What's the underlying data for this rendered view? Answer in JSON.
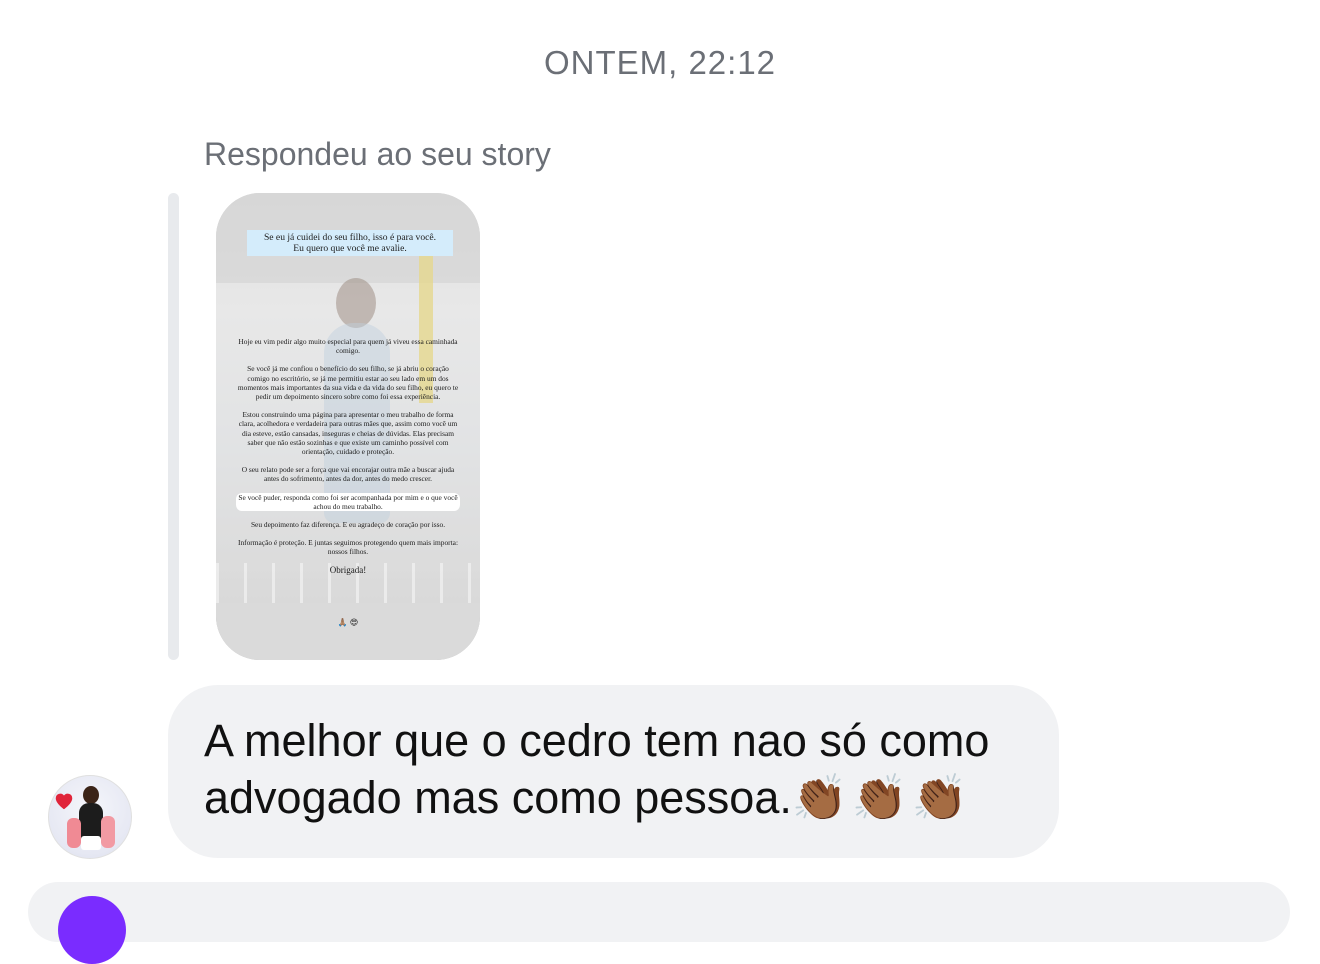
{
  "header": {
    "timestamp": "ONTEM, 22:12"
  },
  "reply": {
    "caption": "Respondeu ao seu story",
    "story": {
      "headline_line1": "Se eu já cuidei do seu filho, isso é para você.",
      "headline_line2": "Eu quero que você me avalie.",
      "paragraphs": [
        "Hoje eu vim pedir algo muito especial para quem já viveu essa caminhada comigo.",
        "Se você já me confiou o benefício do seu filho, se já abriu o coração comigo no escritório, se já me permitiu estar ao seu lado em um dos momentos mais importantes da sua vida e da vida do seu filho, eu quero te pedir um depoimento sincero sobre como foi essa experiência.",
        "Estou construindo uma página para apresentar o meu trabalho de forma clara, acolhedora e verdadeira para outras mães que, assim como você um dia esteve, estão cansadas, inseguras e cheias de dúvidas. Elas precisam saber que não estão sozinhas e que existe um caminho possível com orientação, cuidado e proteção.",
        "O seu relato pode ser a força que vai encorajar outra mãe a buscar ajuda antes do sofrimento, antes da dor, antes do medo crescer.",
        "Se você puder, responda como foi ser acompanhada por mim e o que você achou do meu trabalho.",
        "Seu depoimento faz diferença. E eu agradeço de coração por isso.",
        "Informação é proteção. E juntas seguimos protegendo quem mais importa: nossos filhos.",
        "Obrigada!"
      ],
      "emojis": "🙏🏽 😍"
    }
  },
  "message": {
    "text": "A melhor que o cedro tem nao só como advogado mas como pessoa.",
    "emojis": "👏🏾👏🏾👏🏾"
  },
  "avatar": {
    "icon": "profile-photo"
  },
  "colors": {
    "bubble_bg": "#f1f2f4",
    "meta_text": "#6b6f76",
    "headline_bg": "#d4ecfb",
    "camera_button": "#7a2cff"
  }
}
